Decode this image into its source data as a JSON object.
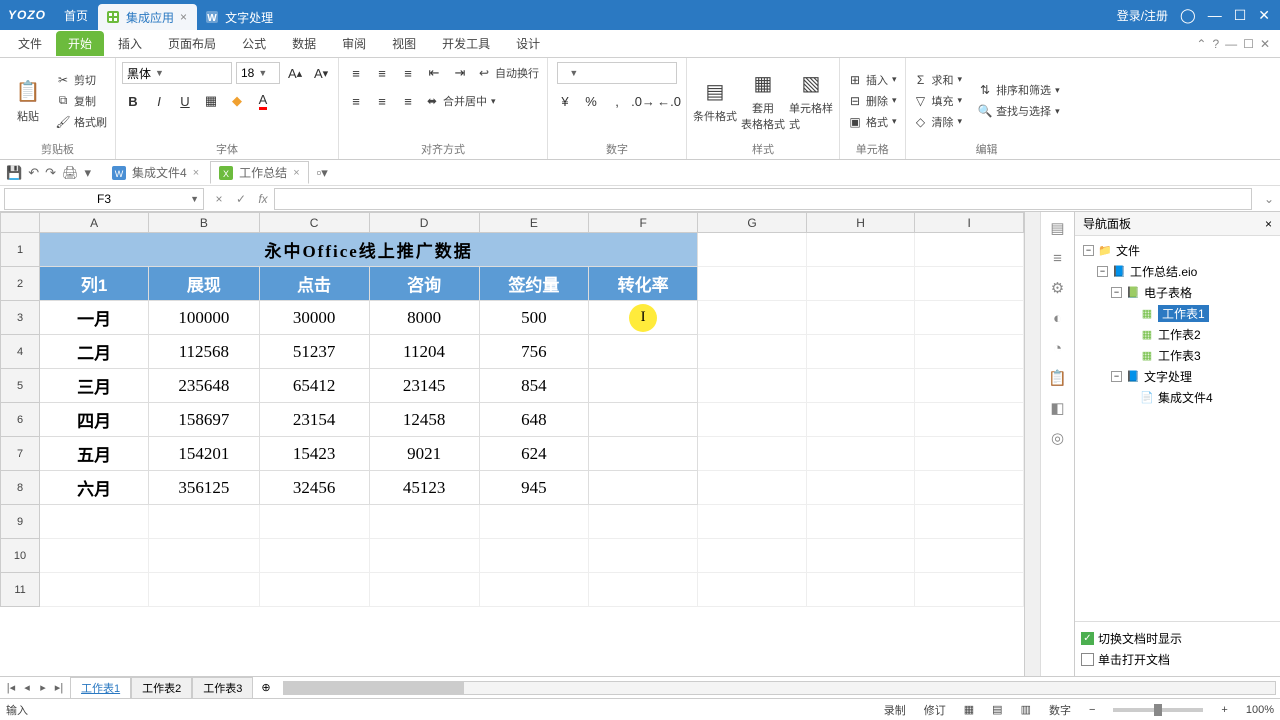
{
  "titlebar": {
    "logo": "YOZO",
    "home": "首页",
    "tabs": [
      {
        "label": "集成应用",
        "kind": "ss",
        "active": true
      },
      {
        "label": "文字处理",
        "kind": "wp",
        "active": false
      }
    ],
    "login": "登录/注册"
  },
  "ribbon_tabs": [
    "文件",
    "开始",
    "插入",
    "页面布局",
    "公式",
    "数据",
    "审阅",
    "视图",
    "开发工具",
    "设计"
  ],
  "ribbon_active": 1,
  "ribbon": {
    "clipboard": {
      "paste": "粘贴",
      "cut": "剪切",
      "copy": "复制",
      "format": "格式刷",
      "label": "剪贴板"
    },
    "font": {
      "name": "黑体",
      "size": "18",
      "label": "字体"
    },
    "align": {
      "wrap": "自动换行",
      "merge": "合并居中",
      "label": "对齐方式"
    },
    "number": {
      "label": "数字"
    },
    "styles": {
      "cond": "条件格式",
      "table": "套用\n表格格式",
      "cell": "单元格样式",
      "label": "样式"
    },
    "cells": {
      "insert": "插入",
      "delete": "删除",
      "format": "格式",
      "label": "单元格"
    },
    "editing": {
      "sum": "求和",
      "fill": "填充",
      "clear": "清除",
      "sort": "排序和筛选",
      "find": "查找与选择",
      "label": "编辑"
    }
  },
  "qat_files": [
    {
      "label": "集成文件4",
      "active": false
    },
    {
      "label": "工作总结",
      "active": true
    }
  ],
  "formula": {
    "name": "F3",
    "fx": "fx",
    "value": ""
  },
  "cols": [
    "A",
    "B",
    "C",
    "D",
    "E",
    "F",
    "G",
    "H",
    "I"
  ],
  "title_row": "永中Office线上推广数据",
  "headers": [
    "列1",
    "展现",
    "点击",
    "咨询",
    "签约量",
    "转化率"
  ],
  "data_rows": [
    [
      "一月",
      "100000",
      "30000",
      "8000",
      "500",
      ""
    ],
    [
      "二月",
      "112568",
      "51237",
      "11204",
      "756",
      ""
    ],
    [
      "三月",
      "235648",
      "65412",
      "23145",
      "854",
      ""
    ],
    [
      "四月",
      "158697",
      "23154",
      "12458",
      "648",
      ""
    ],
    [
      "五月",
      "154201",
      "15423",
      "9021",
      "624",
      ""
    ],
    [
      "六月",
      "356125",
      "32456",
      "45123",
      "945",
      ""
    ]
  ],
  "empty_rows": [
    9,
    10,
    11
  ],
  "nav": {
    "title": "导航面板",
    "root": "文件",
    "items": [
      {
        "lv": 2,
        "icon": "doc",
        "label": "工作总结.eio"
      },
      {
        "lv": 3,
        "icon": "ss",
        "label": "电子表格"
      },
      {
        "lv": 4,
        "icon": "sheet",
        "label": "工作表1",
        "sel": true
      },
      {
        "lv": 4,
        "icon": "sheet",
        "label": "工作表2"
      },
      {
        "lv": 4,
        "icon": "sheet",
        "label": "工作表3"
      },
      {
        "lv": 3,
        "icon": "wp",
        "label": "文字处理"
      },
      {
        "lv": 4,
        "icon": "wpdoc",
        "label": "集成文件4"
      }
    ],
    "opt1": "切换文档时显示",
    "opt2": "单击打开文档"
  },
  "sheets": [
    "工作表1",
    "工作表2",
    "工作表3"
  ],
  "sheet_active": 0,
  "status": {
    "input": "输入",
    "rec": "录制",
    "rev": "修订",
    "num": "数字",
    "zoom": "100%"
  }
}
